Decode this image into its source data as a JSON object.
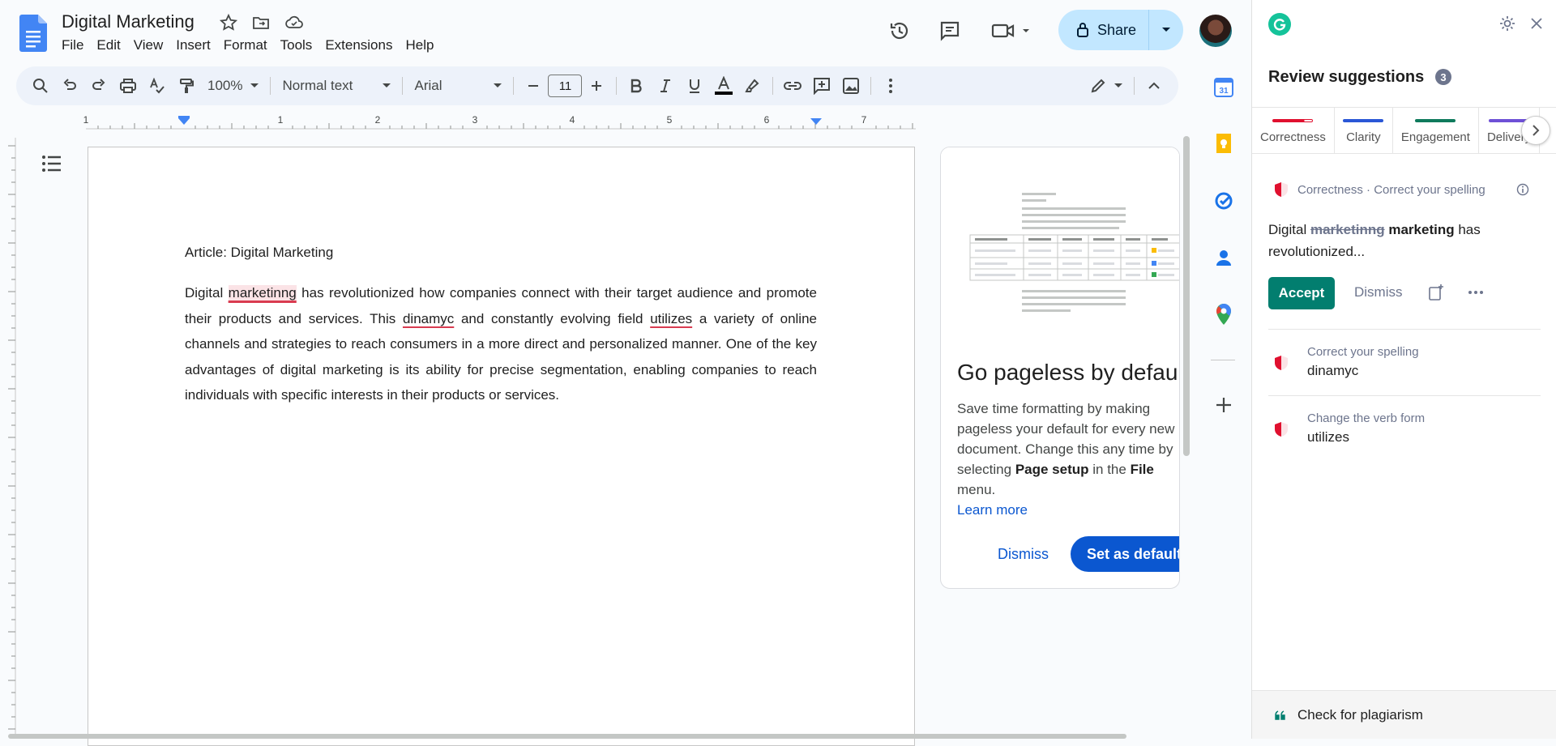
{
  "app": {
    "doc_title": "Digital Marketing",
    "menu": [
      "File",
      "Edit",
      "View",
      "Insert",
      "Format",
      "Tools",
      "Extensions",
      "Help"
    ],
    "share_label": "Share"
  },
  "toolbar": {
    "zoom": "100%",
    "style": "Normal text",
    "font": "Arial",
    "font_size": "11"
  },
  "ruler": {
    "marks": [
      "1",
      "1",
      "2",
      "3",
      "4",
      "5",
      "6",
      "7"
    ]
  },
  "document": {
    "heading": "Article: Digital Marketing",
    "p1_a": "Digital ",
    "p1_err1": "marketinng",
    "p1_b": " has revolutionized how companies connect with their target audience and promote their products and services. This ",
    "p1_err2": "dinamyc",
    "p1_c": " and constantly evolving field ",
    "p1_err3": "utilizes",
    "p1_d": " a variety of online channels and strategies to reach consumers in a more direct and personalized manner. One of the key advantages of digital marketing is its ability for precise segmentation, enabling companies to reach individuals with specific interests in their products or services."
  },
  "pageless_card": {
    "title": "Go pageless by default",
    "text_a": "Save time formatting by making pageless your default for every new document. Change this any time by selecting ",
    "bold_page_setup": "Page setup",
    "text_b": " in the ",
    "bold_file": "File",
    "text_c": " menu.",
    "learn_more": "Learn more",
    "dismiss": "Dismiss",
    "set_default": "Set as default"
  },
  "grammarly": {
    "title": "Review suggestions",
    "count": "3",
    "tabs": [
      {
        "label": "Correctness",
        "color": "#e0102f"
      },
      {
        "label": "Clarity",
        "color": "#2a57d6"
      },
      {
        "label": "Engagement",
        "color": "#0f7a5c"
      },
      {
        "label": "Delivery",
        "color": "#6e50d6"
      }
    ],
    "card": {
      "category": "Correctness · Correct your spelling",
      "snippet_a": "Digital ",
      "snippet_old": "marketinng",
      "snippet_new": "marketing",
      "snippet_b": " has revolutionized...",
      "accept": "Accept",
      "dismiss": "Dismiss"
    },
    "items": [
      {
        "title": "Correct your spelling",
        "word": "dinamyc"
      },
      {
        "title": "Change the verb form",
        "word": "utilizes"
      }
    ],
    "footer": "Check for plagiarism"
  },
  "colors": {
    "accent_blue": "#0b57d0",
    "share_bg": "#c2e7ff",
    "grammarly_green": "#027e6f",
    "error_red": "#d93b50"
  }
}
